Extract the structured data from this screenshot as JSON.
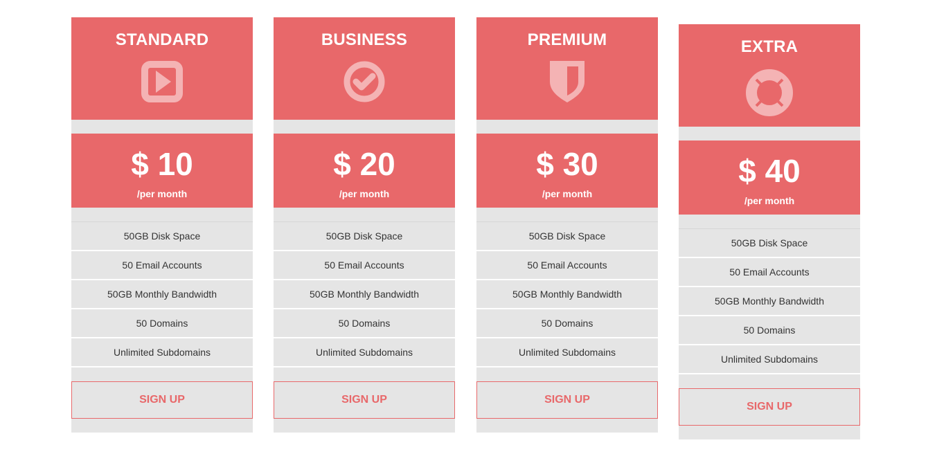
{
  "colors": {
    "accent": "#e8686a",
    "card_background": "#e5e5e5",
    "icon_tint": "#f4b3b4"
  },
  "plans": [
    {
      "name": "STANDARD",
      "icon": "play-square-icon",
      "price": "$ 10",
      "period": "/per month",
      "features": [
        "50GB Disk Space",
        "50 Email Accounts",
        "50GB Monthly Bandwidth",
        "50 Domains",
        "Unlimited Subdomains"
      ],
      "signup_label": "SIGN UP"
    },
    {
      "name": "BUSINESS",
      "icon": "check-circle-icon",
      "price": "$ 20",
      "period": "/per month",
      "features": [
        "50GB Disk Space",
        "50 Email Accounts",
        "50GB Monthly Bandwidth",
        "50 Domains",
        "Unlimited Subdomains"
      ],
      "signup_label": "SIGN UP"
    },
    {
      "name": "PREMIUM",
      "icon": "shield-icon",
      "price": "$ 30",
      "period": "/per month",
      "features": [
        "50GB Disk Space",
        "50 Email Accounts",
        "50GB Monthly Bandwidth",
        "50 Domains",
        "Unlimited Subdomains"
      ],
      "signup_label": "SIGN UP"
    },
    {
      "name": "EXTRA",
      "icon": "lifebuoy-icon",
      "price": "$ 40",
      "period": "/per month",
      "features": [
        "50GB Disk Space",
        "50 Email Accounts",
        "50GB Monthly Bandwidth",
        "50 Domains",
        "Unlimited Subdomains"
      ],
      "signup_label": "SIGN UP"
    }
  ]
}
